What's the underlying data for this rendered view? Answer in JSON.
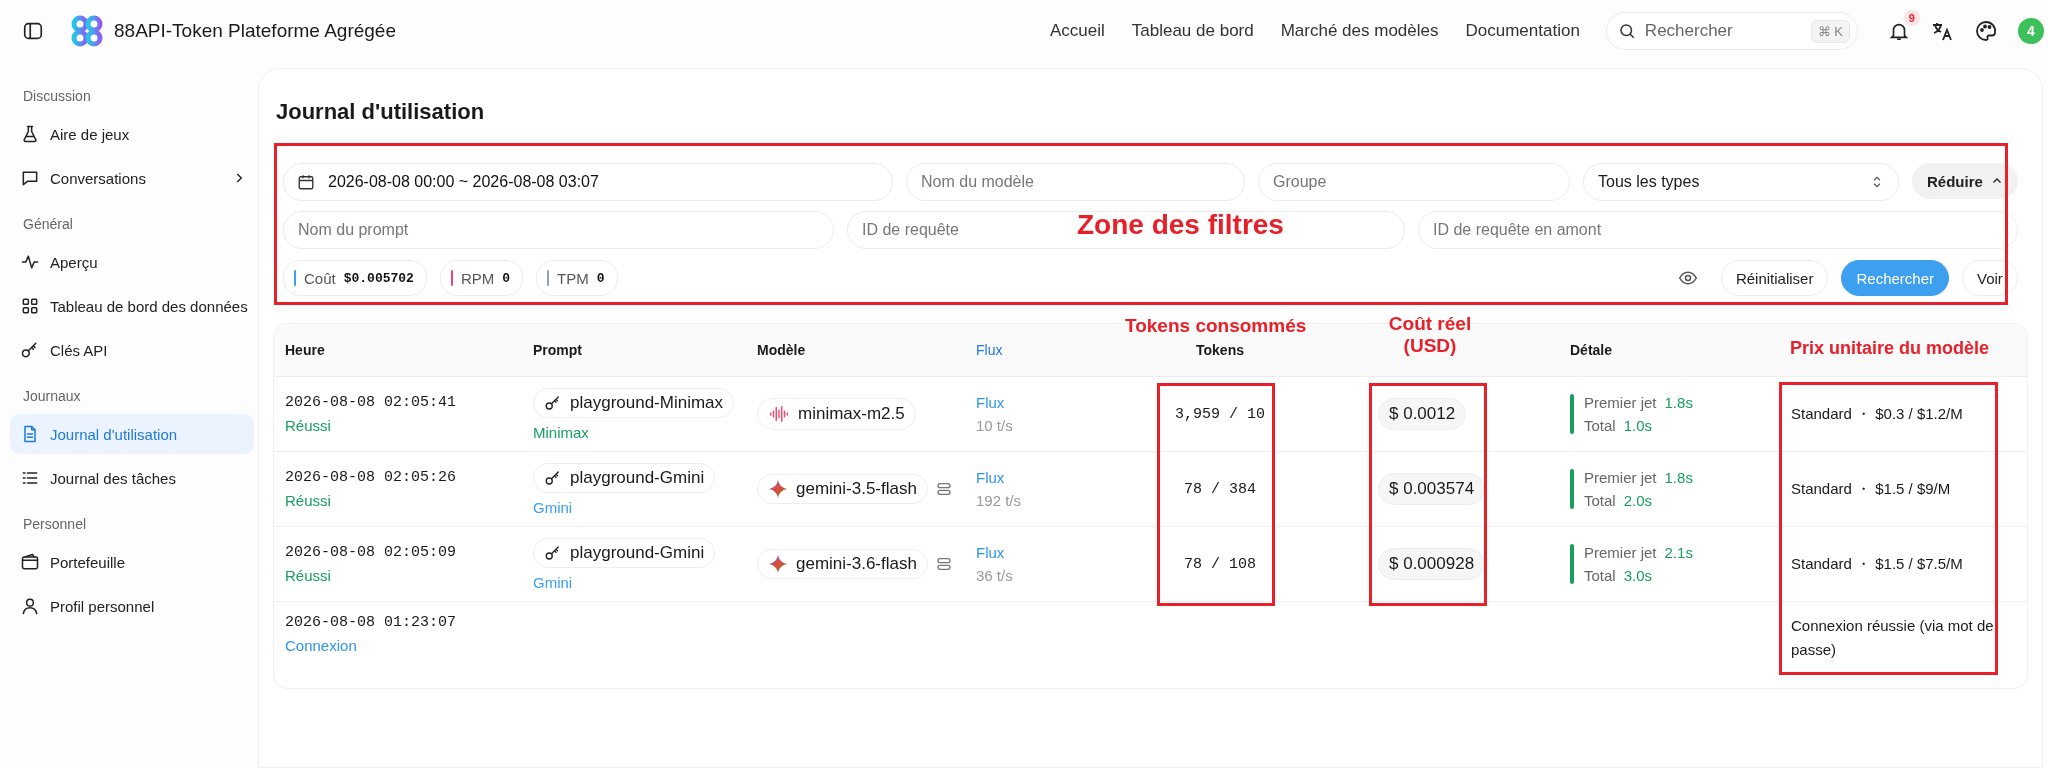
{
  "header": {
    "title": "88API-Token Plateforme Agrégée",
    "nav": [
      {
        "label": "Accueil"
      },
      {
        "label": "Tableau de bord"
      },
      {
        "label": "Marché des modèles"
      },
      {
        "label": "Documentation"
      }
    ],
    "search": {
      "placeholder": "Rechercher",
      "shortcut": "⌘ K"
    },
    "notifications": "9",
    "avatar": "4"
  },
  "sidebar": {
    "sections": [
      {
        "title": "Discussion",
        "items": [
          {
            "label": "Aire de jeux",
            "kind": "link",
            "selected": false
          },
          {
            "label": "Conversations",
            "kind": "group",
            "selected": false
          }
        ]
      },
      {
        "title": "Général",
        "items": [
          {
            "label": "Aperçu",
            "kind": "link",
            "selected": false
          },
          {
            "label": "Tableau de bord des données",
            "kind": "link",
            "selected": false
          },
          {
            "label": "Clés API",
            "kind": "link",
            "selected": false
          }
        ]
      },
      {
        "title": "Journaux",
        "items": [
          {
            "label": "Journal d'utilisation",
            "kind": "link",
            "selected": true
          },
          {
            "label": "Journal des tâches",
            "kind": "link",
            "selected": false
          }
        ]
      },
      {
        "title": "Personnel",
        "items": [
          {
            "label": "Portefeuille",
            "kind": "link",
            "selected": false
          },
          {
            "label": "Profil personnel",
            "kind": "link",
            "selected": false
          }
        ]
      }
    ]
  },
  "page": {
    "title": "Journal d'utilisation"
  },
  "filters": {
    "date_range": "2026-08-08 00:00 ~ 2026-08-08 03:07",
    "row1_fields": [
      {
        "placeholder": "Nom du modèle"
      },
      {
        "placeholder": "Groupe"
      }
    ],
    "type_select": "Tous les types",
    "collapse_button": "Réduire",
    "row2_fields": [
      {
        "placeholder": "Nom du prompt"
      },
      {
        "placeholder": "ID de requête"
      },
      {
        "placeholder": "ID de requête en amont"
      }
    ],
    "stats": [
      {
        "label": "Coût",
        "value": "$0.005702",
        "color": "#3b9ff3"
      },
      {
        "label": "RPM",
        "value": "0",
        "color": "#f0437a"
      },
      {
        "label": "TPM",
        "value": "0",
        "color": "#8aa2c8"
      }
    ],
    "buttons": [
      {
        "label": "Réinitialiser",
        "kind": "default"
      },
      {
        "label": "Rechercher",
        "kind": "primary"
      },
      {
        "label": "Voir",
        "kind": "default"
      }
    ]
  },
  "table": {
    "columns": [
      {
        "label": "Heure",
        "kind": "plain"
      },
      {
        "label": "Prompt",
        "kind": "plain"
      },
      {
        "label": "Modèle",
        "kind": "plain"
      },
      {
        "label": "Flux",
        "kind": "link"
      },
      {
        "label": "Tokens",
        "kind": "plain"
      },
      {
        "label": "Détale",
        "kind": "plain"
      }
    ],
    "rows": [
      {
        "kind": "request",
        "time": "2026-08-08 02:05:41",
        "status": {
          "label": "Réussi",
          "color": "#17a05d"
        },
        "prompt": "playground-Minimax",
        "group": {
          "label": "Minimax",
          "color": "#17a05d"
        },
        "model": {
          "name": "minimax-m2.5",
          "kind": "waveform"
        },
        "routed": false,
        "flux": "Flux",
        "speed": "10 t/s",
        "tokens": "3,959 / 10",
        "cost": "$ 0.0012",
        "first_label": "Premier jet",
        "first": "1.8s",
        "total_label": "Total",
        "total": "1.0s",
        "price": "Standard ・ $0.3 / $1.2/M"
      },
      {
        "kind": "request",
        "time": "2026-08-08 02:05:26",
        "status": {
          "label": "Réussi",
          "color": "#17a05d"
        },
        "prompt": "playground-Gmini",
        "group": {
          "label": "Gmini",
          "color": "#3b9ff3"
        },
        "model": {
          "name": "gemini-3.5-flash",
          "kind": "sparkle"
        },
        "routed": true,
        "flux": "Flux",
        "speed": "192 t/s",
        "tokens": "78 / 384",
        "cost": "$ 0.003574",
        "first_label": "Premier jet",
        "first": "1.8s",
        "total_label": "Total",
        "total": "2.0s",
        "price": "Standard ・ $1.5 / $9/M"
      },
      {
        "kind": "request",
        "time": "2026-08-08 02:05:09",
        "status": {
          "label": "Réussi",
          "color": "#17a05d"
        },
        "prompt": "playground-Gmini",
        "group": {
          "label": "Gmini",
          "color": "#3b9ff3"
        },
        "model": {
          "name": "gemini-3.6-flash",
          "kind": "sparkle"
        },
        "routed": true,
        "flux": "Flux",
        "speed": "36 t/s",
        "tokens": "78 / 108",
        "cost": "$ 0.000928",
        "first_label": "Premier jet",
        "first": "2.1s",
        "total_label": "Total",
        "total": "3.0s",
        "price": "Standard ・ $1.5 / $7.5/M"
      },
      {
        "kind": "login",
        "time": "2026-08-08 01:23:07",
        "status": {
          "label": "Connexion",
          "color": "#2f95ee"
        },
        "price": "Connexion réussie (via mot de passe)"
      }
    ]
  },
  "annotations": {
    "filters_label": "Zone des filtres",
    "tokens_label": "Tokens consommés",
    "cost_label": "Coût réel (USD)",
    "price_label": "Prix unitaire du modèle"
  }
}
